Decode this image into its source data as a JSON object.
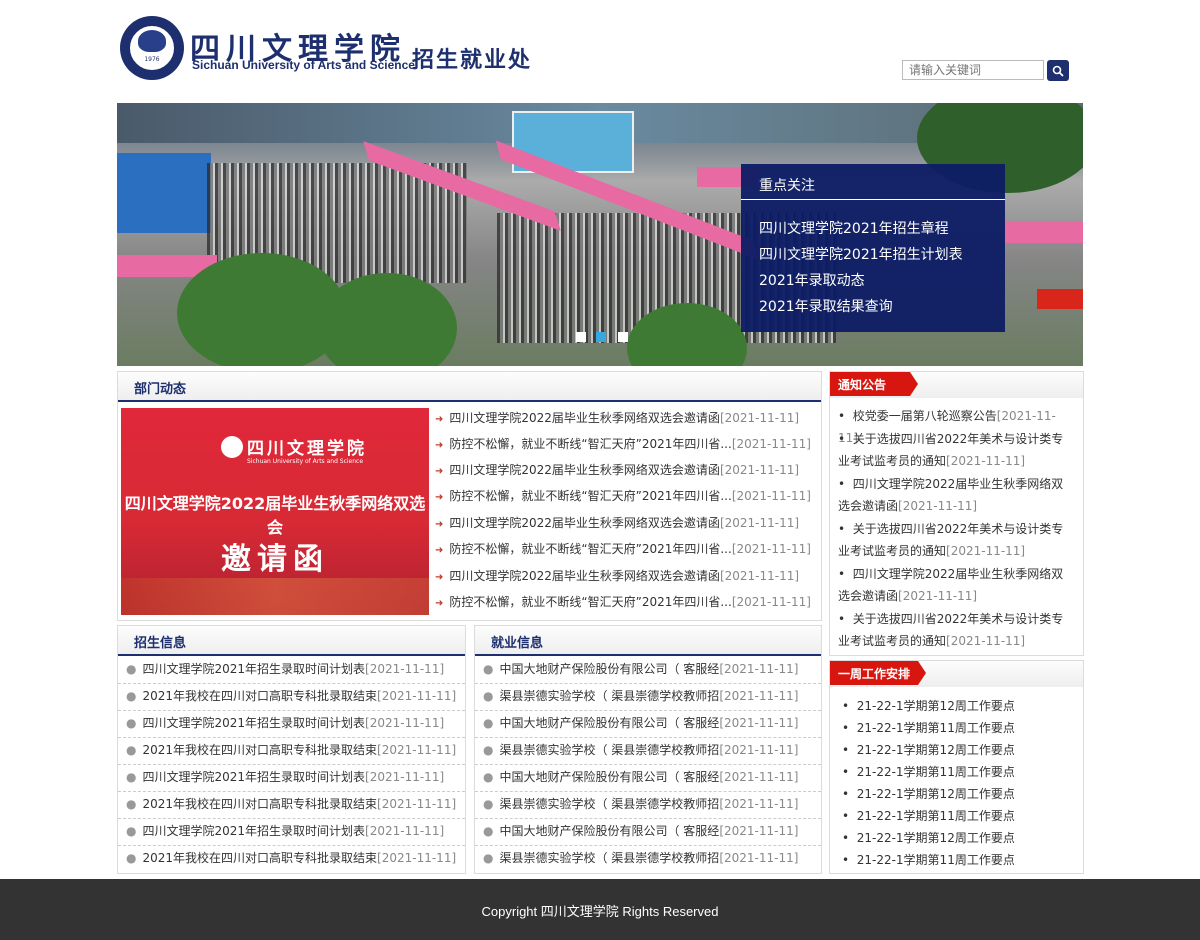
{
  "header": {
    "logo_cn": "四川文理学院",
    "logo_en": "Sichuan University of Arts and Science",
    "logo_year": "1976",
    "dept": "招生就业处",
    "search_placeholder": "请输入关键词"
  },
  "banner": {
    "focus_title": "重点关注",
    "focus_items": [
      "四川文理学院2021年招生章程",
      "四川文理学院2021年招生计划表",
      "2021年录取动态",
      "2021年录取结果查询"
    ],
    "active_slide": 2,
    "slide_count": 3
  },
  "dept_news": {
    "title": "部门动态",
    "image_title_cn": "四川文理学院",
    "image_title_en": "Sichuan University of Arts and Science",
    "image_headline": "四川文理学院2022届毕业生秋季网络双选会",
    "image_big": "邀请函",
    "items": [
      {
        "text": "四川文理学院2022届毕业生秋季网络双选会邀请函",
        "date": "[2021-11-11]"
      },
      {
        "text": "防控不松懈，就业不断线“智汇天府”2021年四川省...",
        "date": "[2021-11-11]"
      },
      {
        "text": "四川文理学院2022届毕业生秋季网络双选会邀请函",
        "date": "[2021-11-11]"
      },
      {
        "text": "防控不松懈，就业不断线“智汇天府”2021年四川省...",
        "date": "[2021-11-11]"
      },
      {
        "text": "四川文理学院2022届毕业生秋季网络双选会邀请函",
        "date": "[2021-11-11]"
      },
      {
        "text": "防控不松懈，就业不断线“智汇天府”2021年四川省...",
        "date": "[2021-11-11]"
      },
      {
        "text": "四川文理学院2022届毕业生秋季网络双选会邀请函",
        "date": "[2021-11-11]"
      },
      {
        "text": "防控不松懈，就业不断线“智汇天府”2021年四川省...",
        "date": "[2021-11-11]"
      }
    ]
  },
  "admissions": {
    "title": "招生信息",
    "items": [
      {
        "text": "四川文理学院2021年招生录取时间计划表",
        "date": "[2021-11-11]"
      },
      {
        "text": "2021年我校在四川对口高职专科批录取结束",
        "date": "[2021-11-11]"
      },
      {
        "text": "四川文理学院2021年招生录取时间计划表",
        "date": "[2021-11-11]"
      },
      {
        "text": "2021年我校在四川对口高职专科批录取结束",
        "date": "[2021-11-11]"
      },
      {
        "text": "四川文理学院2021年招生录取时间计划表",
        "date": "[2021-11-11]"
      },
      {
        "text": "2021年我校在四川对口高职专科批录取结束",
        "date": "[2021-11-11]"
      },
      {
        "text": "四川文理学院2021年招生录取时间计划表",
        "date": "[2021-11-11]"
      },
      {
        "text": "2021年我校在四川对口高职专科批录取结束",
        "date": "[2021-11-11]"
      }
    ]
  },
  "employment": {
    "title": "就业信息",
    "items": [
      {
        "text": "中国大地财产保险股份有限公司（ 客服经",
        "date": "[2021-11-11]"
      },
      {
        "text": "渠县崇德实验学校（ 渠县崇德学校教师招",
        "date": "[2021-11-11]"
      },
      {
        "text": "中国大地财产保险股份有限公司（ 客服经",
        "date": "[2021-11-11]"
      },
      {
        "text": "渠县崇德实验学校（ 渠县崇德学校教师招",
        "date": "[2021-11-11]"
      },
      {
        "text": "中国大地财产保险股份有限公司（ 客服经",
        "date": "[2021-11-11]"
      },
      {
        "text": "渠县崇德实验学校（ 渠县崇德学校教师招",
        "date": "[2021-11-11]"
      },
      {
        "text": "中国大地财产保险股份有限公司（ 客服经",
        "date": "[2021-11-11]"
      },
      {
        "text": "渠县崇德实验学校（ 渠县崇德学校教师招",
        "date": "[2021-11-11]"
      }
    ]
  },
  "notices": {
    "title": "通知公告",
    "items": [
      {
        "text": "校党委一届第八轮巡察公告",
        "date": "[2021-11-11]"
      },
      {
        "text": "关于选拔四川省2022年美术与设计类专业考试监考员的通知",
        "date": "[2021-11-11]"
      },
      {
        "text": "四川文理学院2022届毕业生秋季网络双选会邀请函",
        "date": "[2021-11-11]"
      },
      {
        "text": "关于选拔四川省2022年美术与设计类专业考试监考员的通知",
        "date": "[2021-11-11]"
      },
      {
        "text": "四川文理学院2022届毕业生秋季网络双选会邀请函",
        "date": "[2021-11-11]"
      },
      {
        "text": "关于选拔四川省2022年美术与设计类专业考试监考员的通知",
        "date": "[2021-11-11]"
      }
    ]
  },
  "weekly": {
    "title": "一周工作安排",
    "items": [
      "21-22-1学期第12周工作要点",
      "21-22-1学期第11周工作要点",
      "21-22-1学期第12周工作要点",
      "21-22-1学期第11周工作要点",
      "21-22-1学期第12周工作要点",
      "21-22-1学期第11周工作要点",
      "21-22-1学期第12周工作要点",
      "21-22-1学期第11周工作要点"
    ]
  },
  "footer": {
    "text": "Copyright 四川文理学院 Rights Reserved"
  },
  "colors": {
    "brand": "#1d2f6e",
    "accent": "#d7170f",
    "footer": "#333333"
  }
}
